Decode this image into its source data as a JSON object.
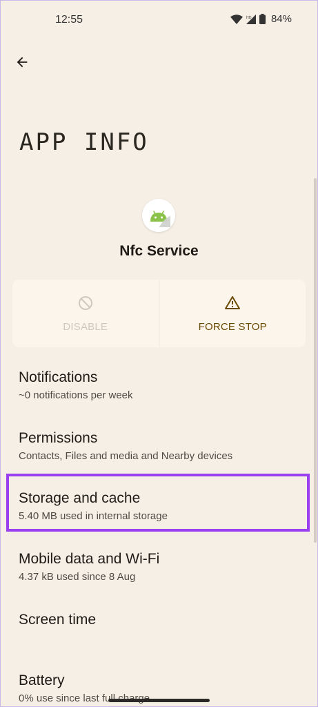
{
  "status_bar": {
    "time": "12:55",
    "battery": "84%"
  },
  "header": {
    "title": "APP INFO"
  },
  "app": {
    "name": "Nfc Service",
    "icon": "android-robot-icon"
  },
  "actions": {
    "disable_label": "DISABLE",
    "force_stop_label": "FORCE STOP"
  },
  "settings": [
    {
      "title": "Notifications",
      "subtitle": "~0 notifications per week"
    },
    {
      "title": "Permissions",
      "subtitle": "Contacts, Files and media and Nearby devices"
    },
    {
      "title": "Storage and cache",
      "subtitle": "5.40 MB used in internal storage"
    },
    {
      "title": "Mobile data and Wi-Fi",
      "subtitle": "4.37 kB used since 8 Aug"
    },
    {
      "title": "Screen time",
      "subtitle": ""
    },
    {
      "title": "Battery",
      "subtitle": "0% use since last full charge"
    }
  ],
  "colors": {
    "background": "#f6efe6",
    "highlight": "#9b40f0",
    "force_stop": "#6b4a00",
    "disabled": "#cfc8bd"
  }
}
